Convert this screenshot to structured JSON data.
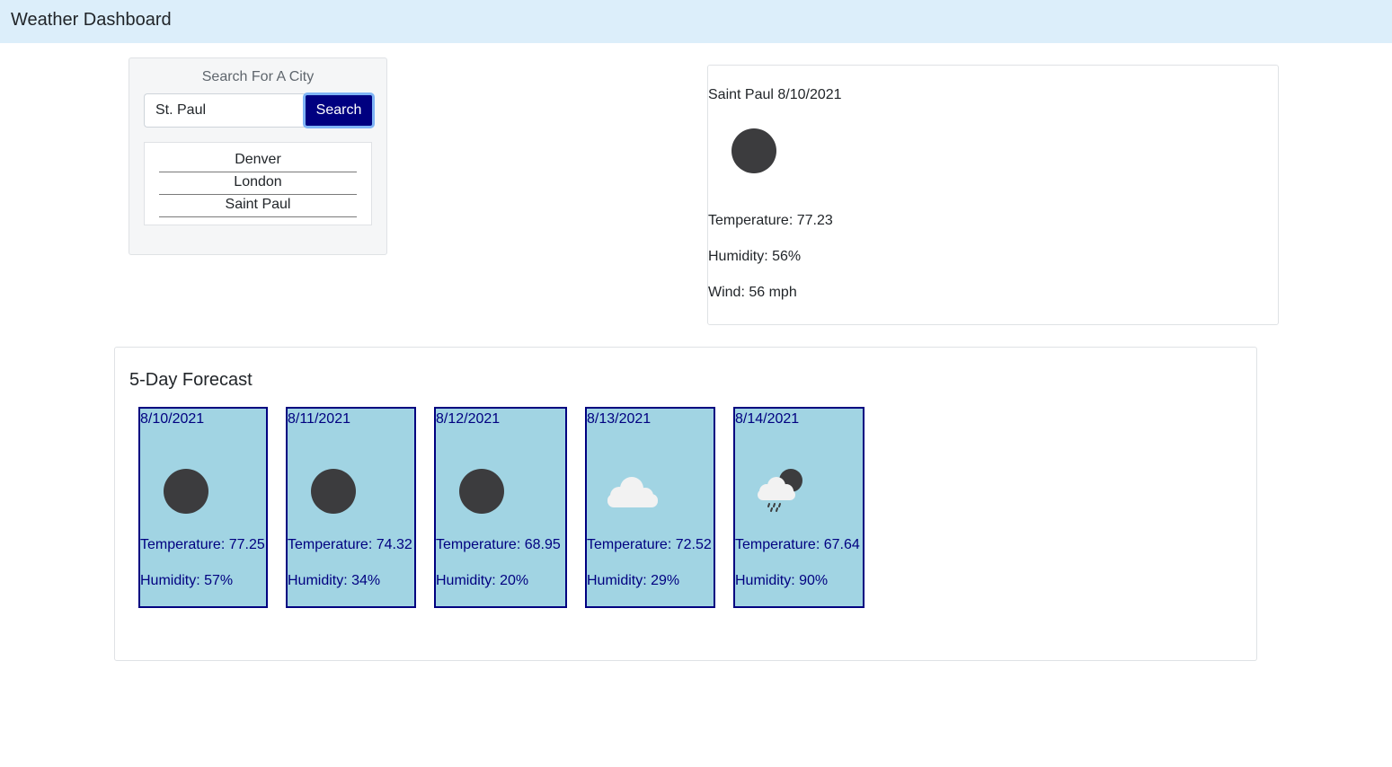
{
  "header": {
    "title": "Weather Dashboard"
  },
  "search": {
    "heading": "Search For A City",
    "input_value": "St. Paul",
    "button_label": "Search",
    "history": [
      "Denver",
      "London",
      "Saint Paul"
    ]
  },
  "current": {
    "title": "Saint Paul 8/10/2021",
    "icon": "full-moon-icon",
    "temperature": "Temperature: 77.23",
    "humidity": "Humidity: 56%",
    "wind": "Wind: 56 mph"
  },
  "forecast": {
    "title": "5-Day Forecast",
    "days": [
      {
        "date": "8/10/2021",
        "icon": "full-moon-icon",
        "temperature": "Temperature: 77.25",
        "humidity": "Humidity: 57%"
      },
      {
        "date": "8/11/2021",
        "icon": "full-moon-icon",
        "temperature": "Temperature: 74.32",
        "humidity": "Humidity: 34%"
      },
      {
        "date": "8/12/2021",
        "icon": "full-moon-icon",
        "temperature": "Temperature: 68.95",
        "humidity": "Humidity: 20%"
      },
      {
        "date": "8/13/2021",
        "icon": "cloud-icon",
        "temperature": "Temperature: 72.52",
        "humidity": "Humidity: 29%"
      },
      {
        "date": "8/14/2021",
        "icon": "rain-night-icon",
        "temperature": "Temperature: 67.64",
        "humidity": "Humidity: 90%"
      }
    ]
  },
  "colors": {
    "header_bg": "#dceefa",
    "accent": "#000080",
    "card_bg": "#a1d4e3",
    "icon_dark": "#3c3c3e"
  }
}
